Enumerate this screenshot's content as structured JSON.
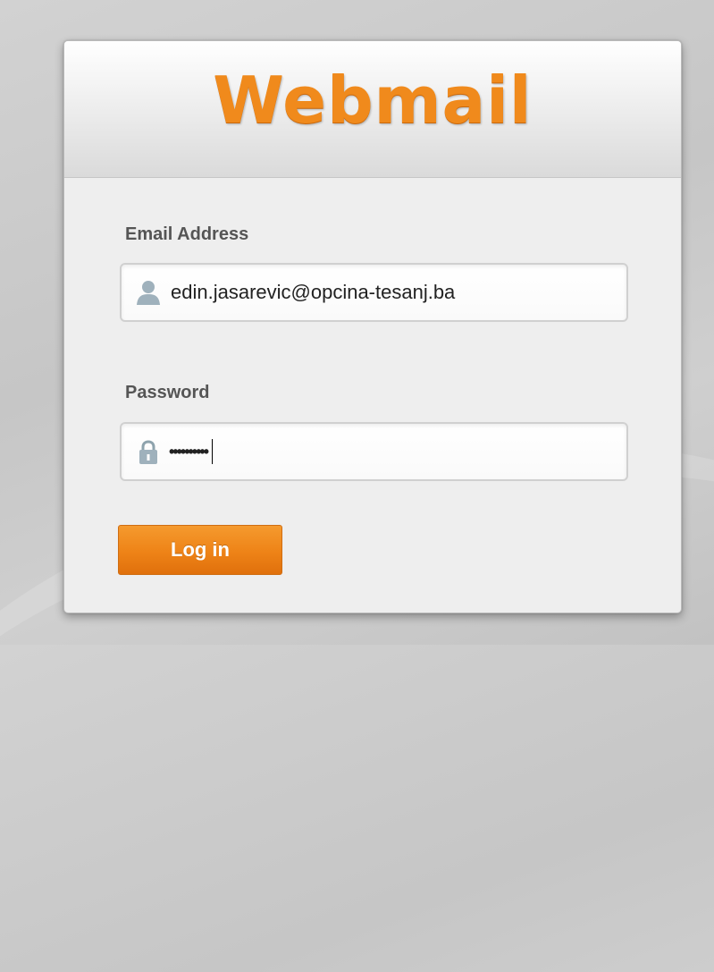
{
  "header": {
    "logo_text": "Webmail"
  },
  "form": {
    "email": {
      "label": "Email Address",
      "value": "edin.jasarevic@opcina-tesanj.ba",
      "icon": "user-icon"
    },
    "password": {
      "label": "Password",
      "masked_value": "••••••••••",
      "icon": "lock-icon"
    },
    "login_button_label": "Log in"
  },
  "colors": {
    "accent": "#f08a1c",
    "button": "#ee8317",
    "label_text": "#555555"
  }
}
